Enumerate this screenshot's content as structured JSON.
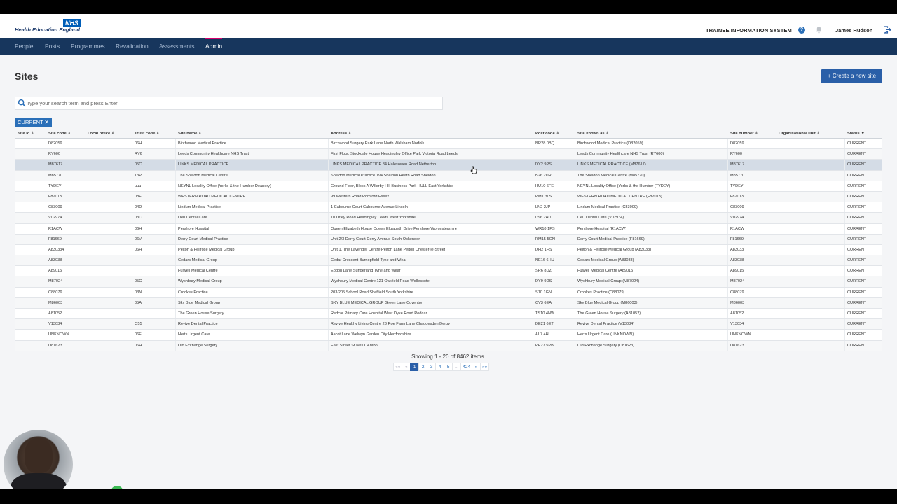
{
  "header": {
    "logo_badge": "NHS",
    "logo_org": "Health Education England",
    "system_name": "TRAINEE INFORMATION SYSTEM",
    "user_name": "James Hudson",
    "help_glyph": "?",
    "icons": [
      "help-icon",
      "bell-icon",
      "logout-icon"
    ]
  },
  "nav": {
    "items": [
      {
        "label": "People",
        "active": false
      },
      {
        "label": "Posts",
        "active": false
      },
      {
        "label": "Programmes",
        "active": false
      },
      {
        "label": "Revalidation",
        "active": false
      },
      {
        "label": "Assessments",
        "active": false
      },
      {
        "label": "Admin",
        "active": true
      }
    ]
  },
  "page": {
    "title": "Sites",
    "create_button": "+ Create a new site"
  },
  "search": {
    "placeholder": "Type your search term and press Enter"
  },
  "filter": {
    "label": "CURRENT",
    "remove": "✕"
  },
  "table": {
    "columns": [
      "Site Id ⇕",
      "Site code ⇕",
      "Local office ⇕",
      "Trust code ⇕",
      "Site name ⇕",
      "Address ⇕",
      "Post code ⇕",
      "Site known as ⇕",
      "Site number ⇕",
      "Organisational unit ⇕",
      "Status ▼"
    ],
    "selected_row": 2,
    "rows": [
      [
        "",
        "D82059",
        "",
        "06H",
        "Birchwood Medical Practice",
        "Birchwood Surgery Park Lane North Walsham Norfolk",
        "NR28 0BQ",
        "Birchwood Medical Practice (D82059)",
        "D82059",
        "",
        "CURRENT"
      ],
      [
        "",
        "RY600",
        "",
        "RY6",
        "Leeds Community Healthcare NHS Trust",
        "First Floor, Stockdale House Headingley Office Park Victoria Road Leeds",
        "",
        "Leeds Community Healthcare NHS Trust (RY600)",
        "RY600",
        "",
        "CURRENT"
      ],
      [
        "",
        "M87617",
        "",
        "05C",
        "LINKS MEDICAL PRACTICE",
        "LINKS MEDICAL PRACTICE 84 Halesowen Road Netherton",
        "DY2 9PS",
        "LINKS MEDICAL PRACTICE (M87617)",
        "M87617",
        "",
        "CURRENT"
      ],
      [
        "",
        "M85770",
        "",
        "13P",
        "The Sheldon Medical Centre",
        "Sheldon Medical Practice 194 Sheldon Heath Road Sheldon",
        "B26 2DR",
        "The Sheldon Medical Centre (M85770)",
        "M85770",
        "",
        "CURRENT"
      ],
      [
        "",
        "TYDEY",
        "",
        "uuu",
        "NEYNL Locality Office (Yorks & the Humber Deanery)",
        "Ground Floor, Block A Willerby Hill Business Park HULL East Yorkshire",
        "HU10 6FE",
        "NEYNL Locality Office (Yorks & the Humber (TYDEY)",
        "TYDEY",
        "",
        "CURRENT"
      ],
      [
        "",
        "F82013",
        "",
        "08F",
        "WESTERN ROAD MEDICAL CENTRE",
        "99 Western Road Romford Essex",
        "RM1 3LS",
        "WESTERN ROAD MEDICAL CENTRE (F82013)",
        "F82013",
        "",
        "CURRENT"
      ],
      [
        "",
        "C83009",
        "",
        "04D",
        "Lindum Medical Practice",
        "1 Cabourne Court Cabourne Avenue Lincoln",
        "LN2 2JP",
        "Lindum Medical Practice (C83009)",
        "C83009",
        "",
        "CURRENT"
      ],
      [
        "",
        "V02974",
        "",
        "03C",
        "Deu Dental Care",
        "10 Otley Road Headingley Leeds West Yorkshire",
        "LS6 2AD",
        "Deu Dental Care (V02974)",
        "V02974",
        "",
        "CURRENT"
      ],
      [
        "",
        "R1ACW",
        "",
        "06H",
        "Pershore Hospital",
        "Queen Elizabeth House Queen Elizabeth Drive Pershore Worcestershire",
        "WR10 1PS",
        "Pershore Hospital (R1ACW)",
        "R1ACW",
        "",
        "CURRENT"
      ],
      [
        "",
        "F81669",
        "",
        "06V",
        "Derry Court Medical Practice",
        "Unit 2/3 Derry Court Derry Avenue South Ockendon",
        "RM15 5GN",
        "Derry Court Medical Practice (F81669)",
        "F81669",
        "",
        "CURRENT"
      ],
      [
        "",
        "A830334",
        "",
        "06H",
        "Pelton & Fellrose Medical Group",
        "Unit 1. The Lavender Centre Pelton Lane Pelton Chester-le-Street",
        "DH2 1HS",
        "Pelton & Fellrose Medical Group (A83033)",
        "A83033",
        "",
        "CURRENT"
      ],
      [
        "",
        "A83038",
        "",
        "",
        "Cedars Medical Group",
        "Cedar Crescent Burnopfield Tyne and Wear",
        "NE16 6HU",
        "Cedars Medical Group (A83038)",
        "A83038",
        "",
        "CURRENT"
      ],
      [
        "",
        "A89015",
        "",
        "",
        "Fulwell Medical Centre",
        "Ebdon Lane Sunderland Tyne and Wear",
        "SR6 8DZ",
        "Fulwell Medical Centre (A89015)",
        "A89015",
        "",
        "CURRENT"
      ],
      [
        "",
        "M87024",
        "",
        "05C",
        "Wychbury Medical Group",
        "Wychbury Medical Centre 121 Oakfield Road Wollescote",
        "DY9 9DS",
        "Wychbury Medical Group (M87024)",
        "M87024",
        "",
        "CURRENT"
      ],
      [
        "",
        "C88079",
        "",
        "03N",
        "Crookes Practice",
        "203/205 School Road Sheffield South Yorkshire",
        "S10 1GN",
        "Crookes Practice (C88079)",
        "C88079",
        "",
        "CURRENT"
      ],
      [
        "",
        "M86003",
        "",
        "05A",
        "Sky Blue Medical Group",
        "SKY BLUE MEDICAL GROUP Green Lane Coventry",
        "CV3 6EA",
        "Sky Blue Medical Group (M86003)",
        "M86003",
        "",
        "CURRENT"
      ],
      [
        "",
        "A81052",
        "",
        "",
        "The Green House Surgery",
        "Redcar Primary Care Hospital West Dyke Road Redcar",
        "TS10 4NW",
        "The Green House Surgery (A81052)",
        "A81052",
        "",
        "CURRENT"
      ],
      [
        "",
        "V13034",
        "",
        "Q55",
        "Revive Dental Practice",
        "Revive Healthy Living Centre 23 Roe Farm Lane Chaddesden Derby",
        "DE21 6ET",
        "Revive Dental Practice (V13034)",
        "V13034",
        "",
        "CURRENT"
      ],
      [
        "",
        "UNKNOWN",
        "",
        "06F",
        "Herts Urgent Care",
        "Ascot Lane Welwyn Garden City Hertfordshire",
        "AL7 4HL",
        "Herts Urgent Care (UNKNOWN)",
        "UNKNOWN",
        "",
        "CURRENT"
      ],
      [
        "",
        "D81623",
        "",
        "06H",
        "Old Exchange Surgery",
        "East Street St Ives CAMBS",
        "PE27 5PB",
        "Old Exchange Surgery (D81623)",
        "D81623",
        "",
        "CURRENT"
      ]
    ]
  },
  "summary": "Showing 1 - 20 of 8462 items.",
  "pagination": [
    "««",
    "«",
    "1",
    "2",
    "3",
    "4",
    "5",
    "...",
    "424",
    "»",
    "»»"
  ],
  "pagination_active": "1",
  "recorder": {
    "controls": [
      "...",
      "✕",
      "II",
      "✓"
    ]
  }
}
